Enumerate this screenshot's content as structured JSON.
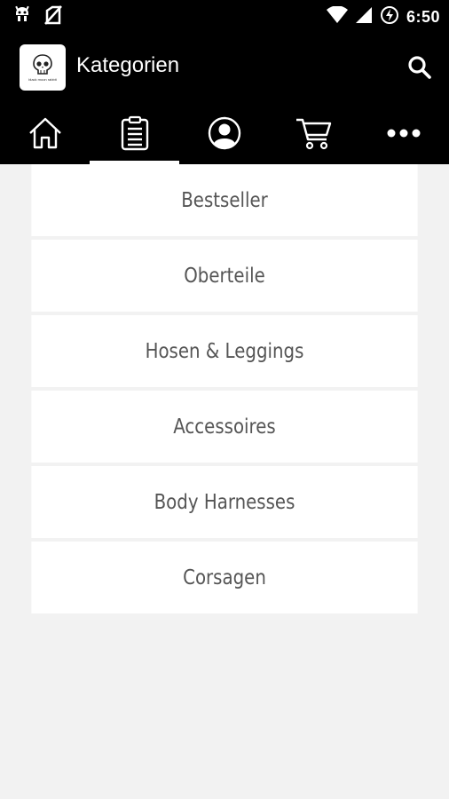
{
  "status_bar": {
    "time": "6:50",
    "icons": [
      "android-debug-icon",
      "no-sim-icon",
      "wifi-icon",
      "signal-icon",
      "battery-charging-icon"
    ]
  },
  "app_bar": {
    "logo_text": "black moon rabbit",
    "title": "Kategorien",
    "search_icon": "search-icon"
  },
  "tabs": [
    {
      "icon": "home-icon",
      "active": false
    },
    {
      "icon": "clipboard-icon",
      "active": true
    },
    {
      "icon": "account-icon",
      "active": false
    },
    {
      "icon": "cart-icon",
      "active": false
    },
    {
      "icon": "more-icon",
      "active": false
    }
  ],
  "categories": [
    {
      "label": "Bestseller"
    },
    {
      "label": "Oberteile"
    },
    {
      "label": "Hosen & Leggings"
    },
    {
      "label": "Accessoires"
    },
    {
      "label": "Body Harnesses"
    },
    {
      "label": "Corsagen"
    }
  ],
  "colors": {
    "bar_bg": "#000000",
    "page_bg": "#f2f2f2",
    "item_bg": "#ffffff",
    "item_text": "#555555"
  }
}
